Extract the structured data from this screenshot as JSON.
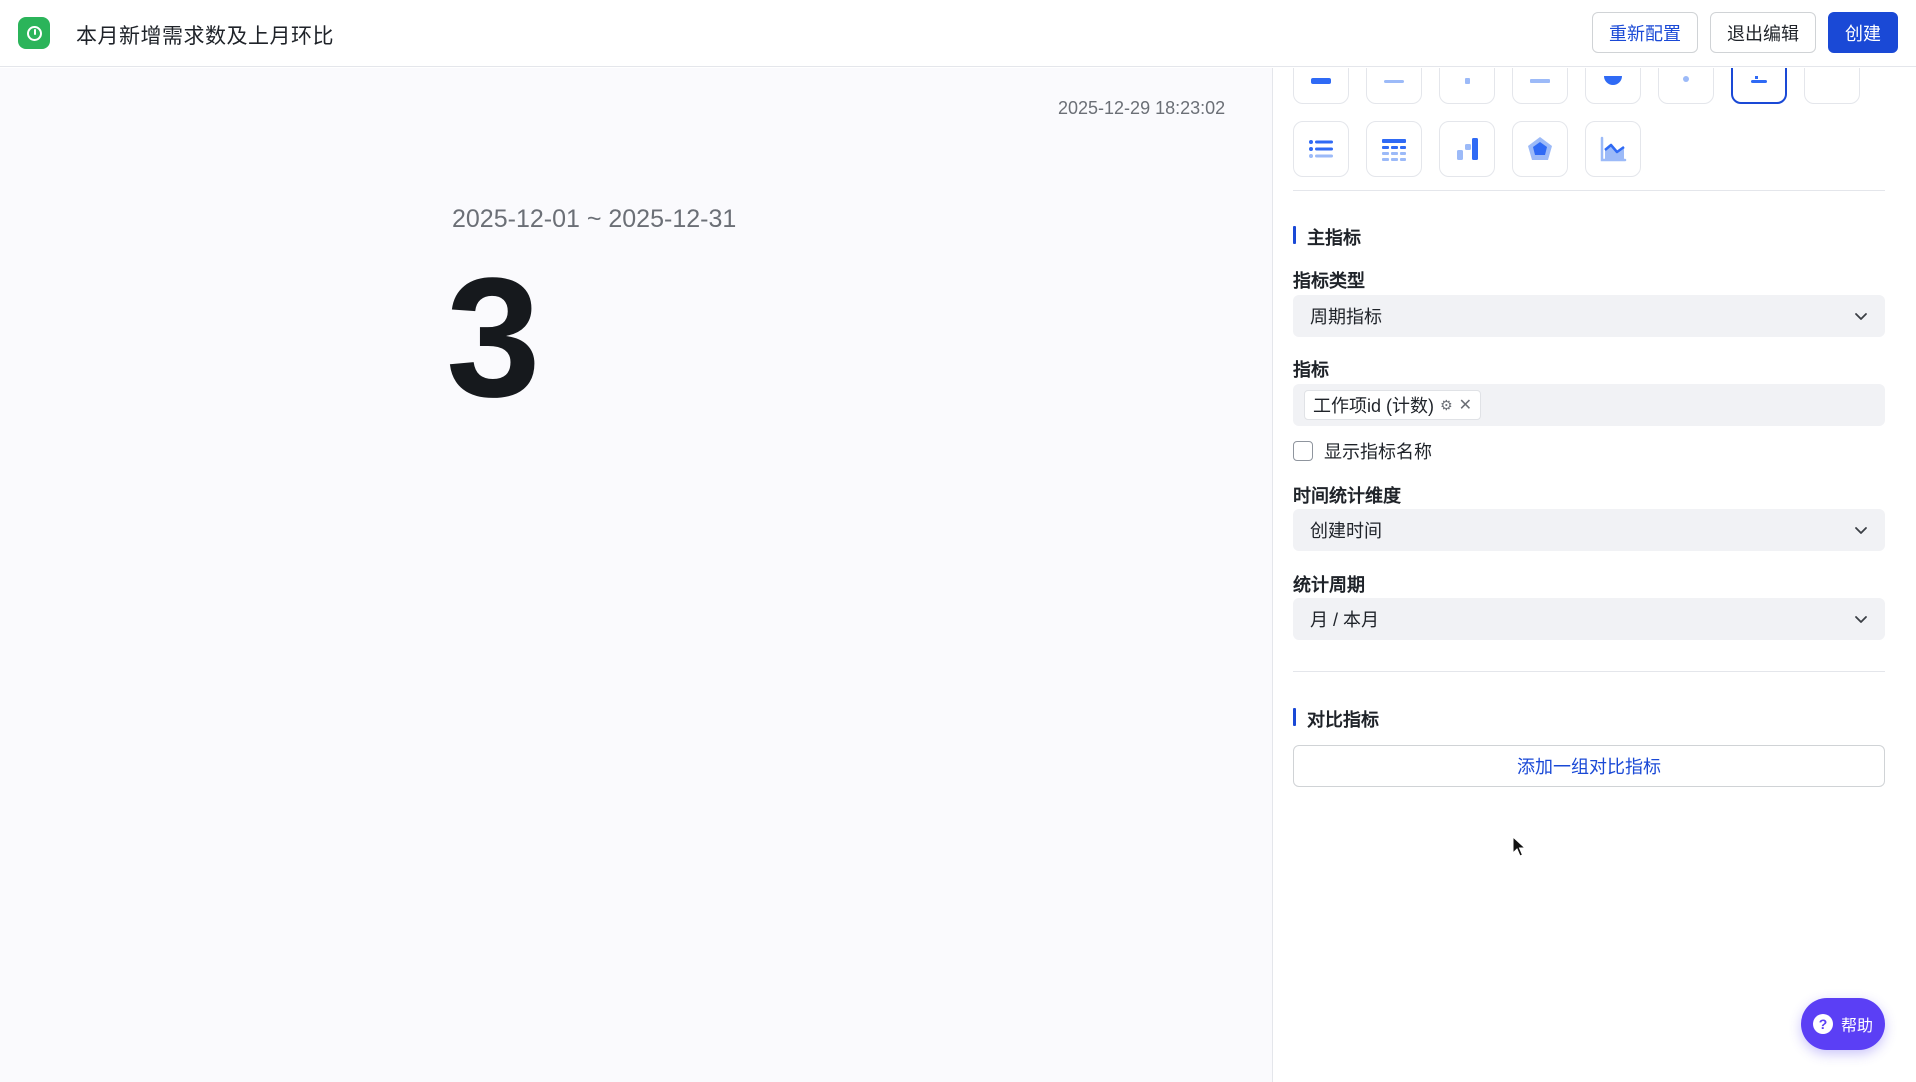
{
  "header": {
    "logo_icon": "app-logo-icon",
    "title": "本月新增需求数及上月环比",
    "buttons": {
      "reconfigure": "重新配置",
      "exit_edit": "退出编辑",
      "create": "创建"
    }
  },
  "main": {
    "timestamp": "2025-12-29 18:23:02",
    "date_range": "2025-12-01 ~ 2025-12-31",
    "value": "3"
  },
  "panel": {
    "chart_types": [
      {
        "icon": "chart-type-icon",
        "active": false
      },
      {
        "icon": "chart-type-icon",
        "active": false
      },
      {
        "icon": "chart-type-icon",
        "active": false
      },
      {
        "icon": "chart-type-icon",
        "active": false
      },
      {
        "icon": "chart-type-icon",
        "active": false
      },
      {
        "icon": "chart-type-icon",
        "active": false
      },
      {
        "icon": "metric-card-icon",
        "active": true
      },
      {
        "icon": "chart-type-icon",
        "active": false
      },
      {
        "icon": "list-icon",
        "active": false
      },
      {
        "icon": "table-icon",
        "active": false
      },
      {
        "icon": "bar-chart-icon",
        "active": false
      },
      {
        "icon": "radar-chart-icon",
        "active": false
      },
      {
        "icon": "area-chart-icon",
        "active": false
      }
    ],
    "main_metric": {
      "section_title": "主指标",
      "metric_type_label": "指标类型",
      "metric_type_value": "周期指标",
      "metric_label": "指标",
      "metric_tag": "工作项id (计数)",
      "show_name_label": "显示指标名称",
      "show_name_checked": false,
      "time_dim_label": "时间统计维度",
      "time_dim_value": "创建时间",
      "period_label": "统计周期",
      "period_value": "月 / 本月"
    },
    "compare_metric": {
      "section_title": "对比指标",
      "add_button": "添加一组对比指标"
    }
  },
  "help": {
    "label": "帮助",
    "icon_glyph": "?"
  },
  "colors": {
    "accent": "#1a49d6",
    "logo": "#2bb45a",
    "help": "#5b3ff5"
  }
}
